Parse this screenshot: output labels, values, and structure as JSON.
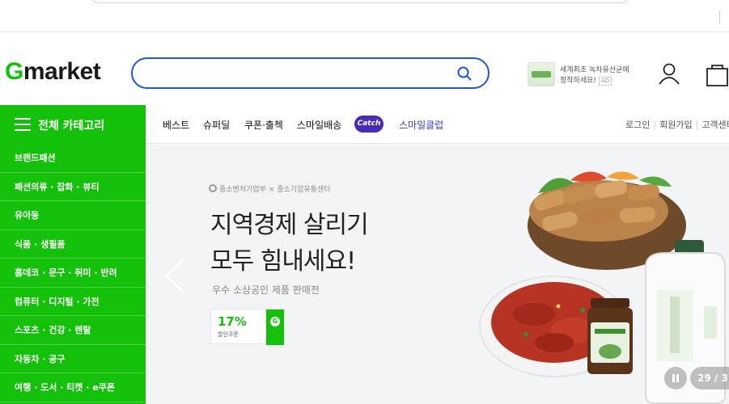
{
  "header": {
    "logo_initial": "G",
    "logo_rest": "market",
    "search_placeholder": "",
    "promo_line1": "세계최초 녹차유산균에",
    "promo_line2": "정착하세요!",
    "promo_ad": "AD"
  },
  "category_button": {
    "label": "전체 카테고리"
  },
  "nav": {
    "items": [
      "베스트",
      "슈퍼딜",
      "쿠폰·출첵",
      "스마일배송"
    ],
    "catch_badge": "Catch",
    "club": "스마일클럽",
    "login": "로그인",
    "signup": "회원가입",
    "service": "고객센터"
  },
  "sidebar": {
    "items": [
      "브랜드패션",
      "패션의류 · 잡화 · 뷰티",
      "유아동",
      "식품 · 생필품",
      "홈데코 · 문구 · 취미 · 반려",
      "컴퓨터 · 디지털 · 가전",
      "스포츠 · 건강 · 렌탈",
      "자동차 · 공구",
      "여행 · 도서 · 티켓 · e쿠폰"
    ]
  },
  "banner": {
    "agencies": "중소벤처기업부 × 중소기업유통센터",
    "headline_1": "지역경제 살리기",
    "headline_2": "모두 힘내세요!",
    "subtitle": "우수 소상공인 제품 판매전",
    "coupon_percent": "17%",
    "coupon_label": "할인쿠폰",
    "coupon_badge": "G",
    "slide_counter": "29 / 3"
  },
  "colors": {
    "brand_green": "#14c10a",
    "search_blue": "#1a58d8",
    "catch_purple": "#4a2ab8"
  }
}
